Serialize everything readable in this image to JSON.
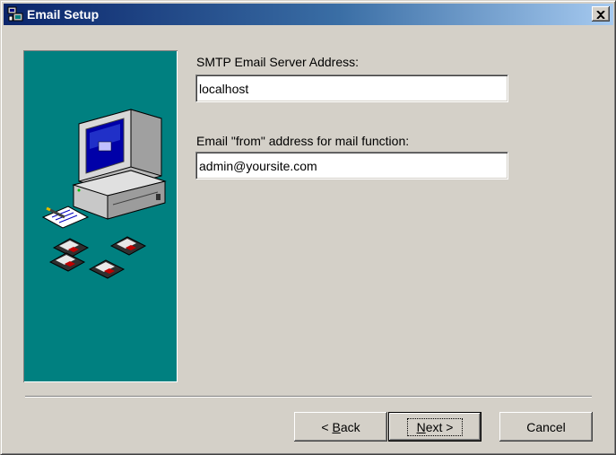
{
  "window": {
    "title": "Email Setup",
    "icon": "setup-computer-icon",
    "close_icon": "close-icon"
  },
  "side_panel": {
    "background": "#008080",
    "illustration": "computer-with-floppy-disks-illustration"
  },
  "form": {
    "smtp_label": "SMTP Email Server Address:",
    "smtp_value": "localhost",
    "from_label": "Email \"from\" address for mail function:",
    "from_value": "admin@yoursite.com"
  },
  "buttons": {
    "back": {
      "prefix": "< ",
      "accel": "B",
      "rest": "ack"
    },
    "next": {
      "accel": "N",
      "rest": "ext >"
    },
    "cancel": "Cancel"
  },
  "colors": {
    "title_gradient_start": "#0a246a",
    "title_gradient_end": "#a6caf0",
    "dialog_face": "#d4d0c8"
  }
}
